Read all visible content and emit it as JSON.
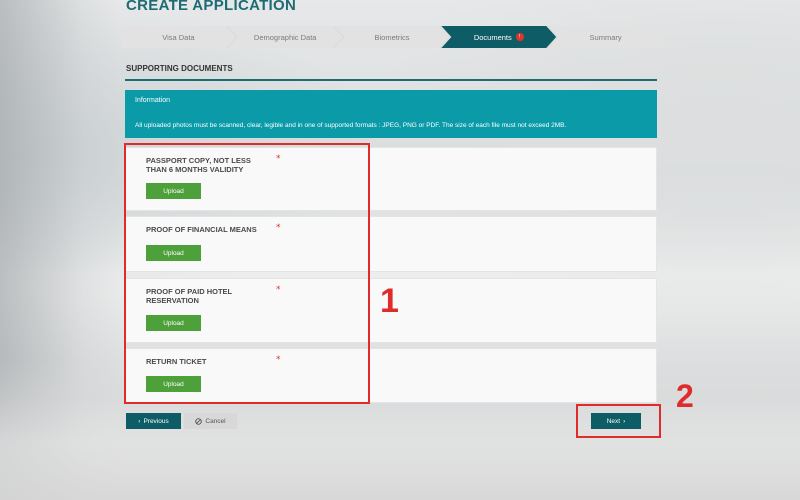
{
  "page": {
    "title": "CREATE APPLICATION"
  },
  "stepper": {
    "steps": [
      {
        "label": "Visa Data"
      },
      {
        "label": "Demographic Data"
      },
      {
        "label": "Biometrics"
      },
      {
        "label": "Documents",
        "badge": "!"
      },
      {
        "label": "Summary"
      }
    ],
    "active_index": 3
  },
  "section": {
    "title": "SUPPORTING DOCUMENTS"
  },
  "info": {
    "title": "Information",
    "text": "All uploaded photos must be scanned, clear, legible and in one of supported formats : JPEG, PNG or PDF. The size of each file must not exceed 2MB."
  },
  "documents": [
    {
      "label": "PASSPORT COPY, NOT LESS THAN 6 MONTHS VALIDITY",
      "required_mark": "*",
      "upload_label": "Upload"
    },
    {
      "label": "PROOF OF FINANCIAL MEANS",
      "required_mark": "*",
      "upload_label": "Upload"
    },
    {
      "label": "PROOF OF PAID HOTEL RESERVATION",
      "required_mark": "*",
      "upload_label": "Upload"
    },
    {
      "label": "RETURN TICKET",
      "required_mark": "*",
      "upload_label": "Upload"
    }
  ],
  "nav": {
    "previous_label": "Previous",
    "cancel_label": "Cancel",
    "next_label": "Next"
  },
  "annotations": {
    "label_1": "1",
    "label_2": "2"
  },
  "colors": {
    "teal_dark": "#0e5c65",
    "teal_info": "#0a9aa8",
    "upload_green": "#4da03a",
    "annotation_red": "#e02b2b",
    "required_red": "#d9362f"
  }
}
